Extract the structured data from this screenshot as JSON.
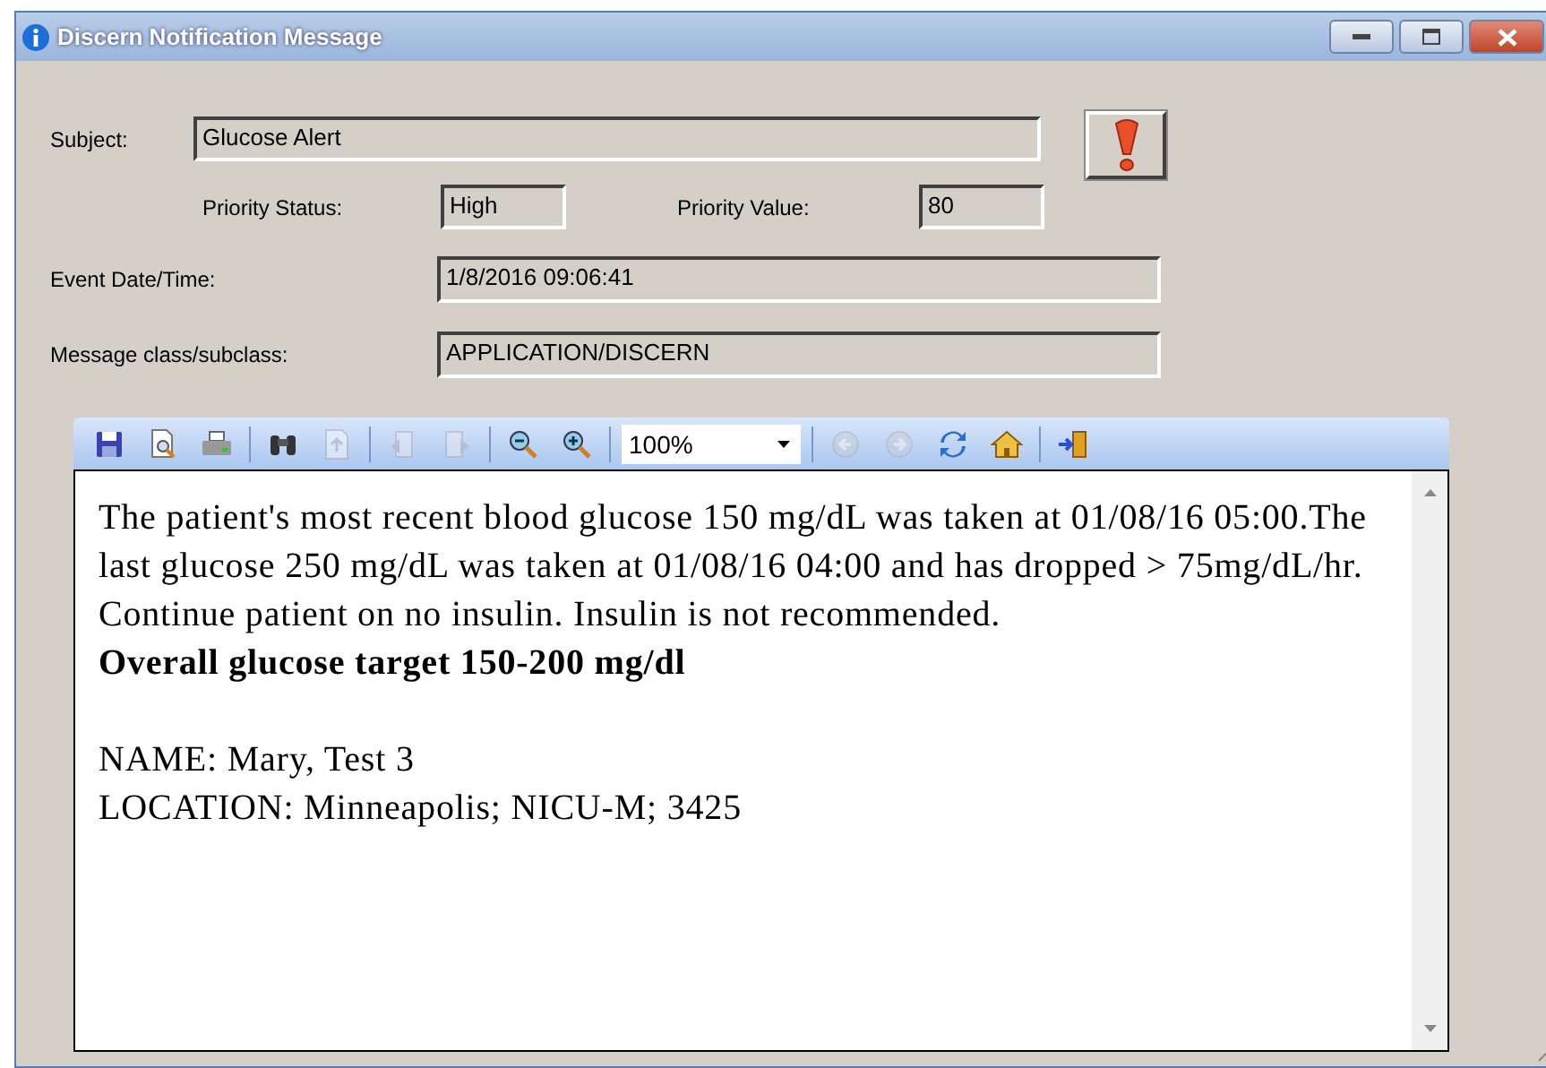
{
  "window": {
    "title": "Discern Notification Message"
  },
  "subject": {
    "label": "Subject:",
    "value": "Glucose Alert"
  },
  "priority_status": {
    "label": "Priority Status:",
    "value": "High"
  },
  "priority_value": {
    "label": "Priority Value:",
    "value": "80"
  },
  "event_datetime": {
    "label": "Event Date/Time:",
    "value": "1/8/2016 09:06:41"
  },
  "message_class": {
    "label": "Message class/subclass:",
    "value": "APPLICATION/DISCERN"
  },
  "toolbar": {
    "groups": [
      [
        {
          "kind": "save",
          "disabled": false
        },
        {
          "kind": "preview",
          "disabled": false
        },
        {
          "kind": "print",
          "disabled": false
        }
      ],
      [
        {
          "kind": "find",
          "disabled": false
        },
        {
          "kind": "export",
          "disabled": true
        }
      ],
      [
        {
          "kind": "prev-page",
          "disabled": true
        },
        {
          "kind": "next-page",
          "disabled": true
        }
      ],
      [
        {
          "kind": "zoom-out",
          "disabled": false
        },
        {
          "kind": "zoom-in",
          "disabled": false
        }
      ],
      [
        {
          "kind": "zoom",
          "value": "100%"
        }
      ],
      [
        {
          "kind": "back",
          "disabled": true
        },
        {
          "kind": "forward",
          "disabled": true
        },
        {
          "kind": "refresh",
          "disabled": false
        },
        {
          "kind": "home",
          "disabled": false
        }
      ],
      [
        {
          "kind": "exit",
          "disabled": false
        }
      ]
    ]
  },
  "message": {
    "blocks": [
      [
        {
          "text": "The patient's most recent blood glucose 150 mg/dL was taken at 01/08/16 05:00.The last glucose 250 mg/dL was taken at 01/08/16 04:00 and has dropped > 75mg/dL/hr. Continue patient on no insulin. Insulin is not recommended.",
          "bold": false
        },
        {
          "text": "Overall glucose target 150-200 mg/dl",
          "bold": true
        }
      ],
      [
        {
          "text": "NAME: Mary, Test 3",
          "bold": false
        },
        {
          "text": "LOCATION: Minneapolis; NICU-M; 3425",
          "bold": false
        }
      ]
    ]
  }
}
